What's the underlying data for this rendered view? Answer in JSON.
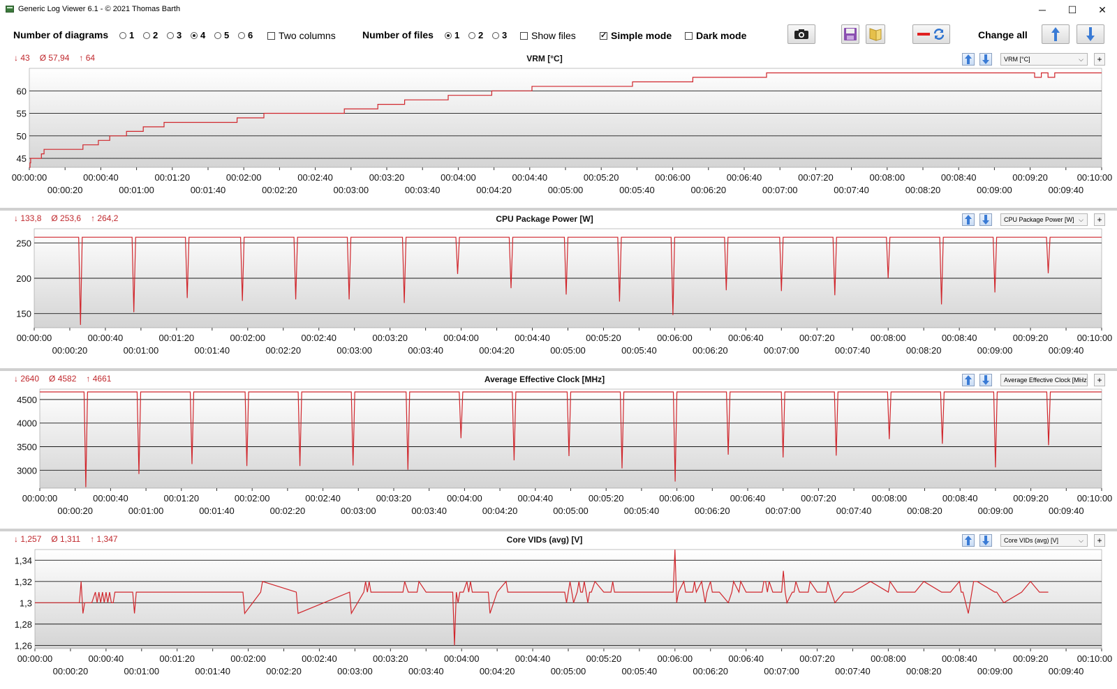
{
  "window": {
    "title": "Generic Log Viewer 6.1 - © 2021 Thomas Barth",
    "min_label": "─",
    "max_label": "☐",
    "close_label": "✕"
  },
  "toolbar": {
    "diagrams_label": "Number of diagrams",
    "diagram_options": [
      "1",
      "2",
      "3",
      "4",
      "5",
      "6"
    ],
    "diagram_selected": "4",
    "two_columns_label": "Two columns",
    "two_columns_checked": false,
    "files_label": "Number of files",
    "file_options": [
      "1",
      "2",
      "3"
    ],
    "file_selected": "1",
    "show_files_label": "Show files",
    "show_files_checked": false,
    "simple_mode_label": "Simple mode",
    "simple_mode_checked": true,
    "dark_mode_label": "Dark mode",
    "dark_mode_checked": false,
    "change_all_label": "Change all",
    "icons": [
      "camera-icon",
      "save-icon",
      "open-folder-icon",
      "remove-line-icon",
      "refresh-icon",
      "arrow-up-icon",
      "arrow-down-icon"
    ]
  },
  "colors": {
    "series": "#d0262c",
    "stats": "#c0282d",
    "button_blue": "#3a7bd5"
  },
  "time_labels": {
    "upper": [
      "00:00:00",
      "00:00:40",
      "00:01:20",
      "00:02:00",
      "00:02:40",
      "00:03:20",
      "00:04:00",
      "00:04:40",
      "00:05:20",
      "00:06:00",
      "00:06:40",
      "00:07:20",
      "00:08:00",
      "00:08:40",
      "00:09:20",
      "00:10:00"
    ],
    "lower": [
      "00:00:20",
      "00:01:00",
      "00:01:40",
      "00:02:20",
      "00:03:00",
      "00:03:40",
      "00:04:20",
      "00:05:00",
      "00:05:40",
      "00:06:20",
      "00:07:00",
      "00:07:40",
      "00:08:20",
      "00:09:00",
      "00:09:40"
    ]
  },
  "chart_data": [
    {
      "type": "line",
      "title": "VRM [°C]",
      "selector": "VRM [°C]",
      "stats": {
        "min": "↓ 43",
        "avg": "Ø 57,94",
        "max": "↑ 64"
      },
      "x_range_seconds": [
        0,
        600
      ],
      "yticks": [
        "45",
        "50",
        "55",
        "60"
      ],
      "ylim": [
        43,
        65
      ],
      "x": [
        0,
        1,
        2,
        4,
        6,
        9,
        12,
        15,
        18,
        20,
        22,
        24,
        26,
        28,
        30,
        32,
        34,
        36,
        38,
        40,
        42,
        44,
        46,
        50,
        55,
        65,
        80,
        80,
        100,
        103,
        120,
        120,
        140,
        145,
        160,
        170,
        170,
        200,
        201,
        230,
        240,
        275,
        278,
        310,
        330,
        340,
        350,
        350,
        390,
        400,
        420,
        440,
        470,
        470,
        520,
        520,
        550,
        560,
        580,
        580,
        610,
        620,
        625,
        640,
        650,
        660,
        670,
        690,
        700,
        720,
        735,
        750,
        780,
        790,
        810,
        900,
        900,
        990,
        990,
        1100,
        1100,
        1200,
        1200,
        1340,
        1340,
        1420,
        1420,
        1490,
        1500,
        1500,
        1510,
        1520,
        1530,
        1560,
        1600
      ],
      "values": [
        43,
        44,
        45,
        45,
        45,
        45,
        45,
        45,
        46,
        46,
        47,
        47,
        47,
        47,
        47,
        47,
        47,
        47,
        47,
        47,
        47,
        47,
        47,
        47,
        47,
        47,
        47,
        48,
        48,
        49,
        49,
        50,
        50,
        51,
        51,
        51,
        52,
        52,
        53,
        53,
        53,
        53,
        53,
        54,
        54,
        54,
        54,
        55,
        55,
        55,
        55,
        55,
        55,
        56,
        56,
        57,
        57,
        58,
        58,
        58,
        58,
        58,
        59,
        59,
        59,
        59,
        59,
        60,
        60,
        60,
        60,
        61,
        61,
        61,
        61,
        61,
        62,
        62,
        63,
        63,
        64,
        64,
        64,
        64,
        64,
        64,
        64,
        64,
        63,
        63,
        64,
        63,
        64,
        64,
        64
      ]
    },
    {
      "type": "line",
      "title": "CPU Package Power [W]",
      "selector": "CPU Package Power [W]",
      "stats": {
        "min": "↓ 133,8",
        "avg": "Ø 253,6",
        "max": "↑ 264,2"
      },
      "x_range_seconds": [
        0,
        600
      ],
      "yticks": [
        "150",
        "200",
        "250"
      ],
      "ylim": [
        130,
        270
      ],
      "spikes": [
        {
          "t": 26,
          "v": 134
        },
        {
          "t": 56,
          "v": 152
        },
        {
          "t": 86,
          "v": 172
        },
        {
          "t": 117,
          "v": 168
        },
        {
          "t": 147,
          "v": 170
        },
        {
          "t": 177,
          "v": 170
        },
        {
          "t": 208,
          "v": 165
        },
        {
          "t": 238,
          "v": 206
        },
        {
          "t": 268,
          "v": 186
        },
        {
          "t": 299,
          "v": 177
        },
        {
          "t": 329,
          "v": 167
        },
        {
          "t": 359,
          "v": 148
        },
        {
          "t": 389,
          "v": 183
        },
        {
          "t": 420,
          "v": 182
        },
        {
          "t": 450,
          "v": 176
        },
        {
          "t": 480,
          "v": 200
        },
        {
          "t": 510,
          "v": 163
        },
        {
          "t": 540,
          "v": 180
        },
        {
          "t": 570,
          "v": 207
        }
      ],
      "baseline": 258
    },
    {
      "type": "line",
      "title": "Average Effective Clock [MHz]",
      "selector": "Average Effective Clock [MHz]",
      "stats": {
        "min": "↓ 2640",
        "avg": "Ø 4582",
        "max": "↑ 4661"
      },
      "x_range_seconds": [
        0,
        600
      ],
      "yticks": [
        "3000",
        "3500",
        "4000",
        "4500"
      ],
      "ylim": [
        2620,
        4720
      ],
      "spikes": [
        {
          "t": 26,
          "v": 2640
        },
        {
          "t": 56,
          "v": 2920
        },
        {
          "t": 86,
          "v": 3130
        },
        {
          "t": 117,
          "v": 3090
        },
        {
          "t": 147,
          "v": 3090
        },
        {
          "t": 177,
          "v": 3100
        },
        {
          "t": 208,
          "v": 3010
        },
        {
          "t": 238,
          "v": 3680
        },
        {
          "t": 268,
          "v": 3210
        },
        {
          "t": 299,
          "v": 3300
        },
        {
          "t": 329,
          "v": 3040
        },
        {
          "t": 359,
          "v": 2760
        },
        {
          "t": 389,
          "v": 3330
        },
        {
          "t": 420,
          "v": 3270
        },
        {
          "t": 450,
          "v": 3310
        },
        {
          "t": 480,
          "v": 3660
        },
        {
          "t": 510,
          "v": 3560
        },
        {
          "t": 540,
          "v": 3060
        },
        {
          "t": 570,
          "v": 3530
        }
      ],
      "baseline": 4661
    },
    {
      "type": "line",
      "title": "Core VIDs (avg) [V]",
      "selector": "Core VIDs (avg) [V]",
      "stats": {
        "min": "↓ 1,257",
        "avg": "Ø 1,311",
        "max": "↑ 1,347"
      },
      "x_range_seconds": [
        0,
        600
      ],
      "yticks": [
        "1,26",
        "1,28",
        "1,3",
        "1,32",
        "1,34"
      ],
      "ylim": [
        1.257,
        1.35
      ],
      "x": [
        0,
        25,
        26,
        27,
        28,
        30,
        32,
        34,
        35,
        36,
        37,
        38,
        39,
        40,
        41,
        42,
        43,
        44,
        45,
        46,
        55,
        56,
        57,
        58,
        80,
        117,
        118,
        127,
        128,
        147,
        148,
        177,
        178,
        185,
        186,
        187,
        188,
        189,
        190,
        200,
        207,
        208,
        210,
        215,
        216,
        220,
        230,
        235,
        236,
        237,
        238,
        239,
        240,
        241,
        243,
        244,
        245,
        246,
        250,
        255,
        256,
        260,
        265,
        266,
        270,
        280,
        290,
        298,
        299,
        300,
        301,
        302,
        303,
        305,
        306,
        307,
        308,
        309,
        310,
        311,
        312,
        313,
        315,
        320,
        324,
        325,
        326,
        330,
        340,
        350,
        359,
        360,
        361,
        362,
        365,
        366,
        370,
        371,
        372,
        375,
        376,
        377,
        378,
        380,
        381,
        383,
        385,
        390,
        392,
        393,
        396,
        397,
        400,
        405,
        409,
        410,
        411,
        412,
        413,
        415,
        420,
        421,
        422,
        423,
        426,
        427,
        428,
        430,
        435,
        436,
        440,
        445,
        446,
        450,
        455,
        460,
        470,
        480,
        481,
        485,
        490,
        495,
        500,
        510,
        515,
        520,
        521,
        522,
        525,
        527,
        528,
        530,
        540,
        541,
        545,
        555,
        560,
        565,
        566,
        570,
        575,
        580,
        585,
        590,
        600
      ],
      "values": [
        1.3,
        1.3,
        1.32,
        1.29,
        1.3,
        1.3,
        1.3,
        1.31,
        1.3,
        1.31,
        1.3,
        1.31,
        1.3,
        1.31,
        1.3,
        1.31,
        1.3,
        1.3,
        1.31,
        1.31,
        1.31,
        1.29,
        1.31,
        1.31,
        1.31,
        1.31,
        1.29,
        1.31,
        1.32,
        1.31,
        1.29,
        1.31,
        1.29,
        1.31,
        1.32,
        1.31,
        1.32,
        1.31,
        1.31,
        1.31,
        1.31,
        1.32,
        1.31,
        1.31,
        1.32,
        1.31,
        1.31,
        1.31,
        1.26,
        1.31,
        1.3,
        1.31,
        1.31,
        1.31,
        1.32,
        1.31,
        1.32,
        1.31,
        1.31,
        1.31,
        1.29,
        1.31,
        1.32,
        1.31,
        1.31,
        1.31,
        1.31,
        1.31,
        1.3,
        1.31,
        1.32,
        1.31,
        1.3,
        1.31,
        1.32,
        1.31,
        1.31,
        1.32,
        1.31,
        1.3,
        1.31,
        1.31,
        1.32,
        1.31,
        1.31,
        1.32,
        1.31,
        1.31,
        1.31,
        1.31,
        1.31,
        1.35,
        1.3,
        1.31,
        1.32,
        1.31,
        1.31,
        1.32,
        1.31,
        1.32,
        1.31,
        1.3,
        1.31,
        1.32,
        1.31,
        1.31,
        1.31,
        1.3,
        1.31,
        1.32,
        1.31,
        1.32,
        1.31,
        1.31,
        1.31,
        1.32,
        1.32,
        1.31,
        1.32,
        1.31,
        1.31,
        1.33,
        1.31,
        1.3,
        1.31,
        1.31,
        1.32,
        1.31,
        1.31,
        1.32,
        1.31,
        1.31,
        1.32,
        1.3,
        1.31,
        1.31,
        1.32,
        1.31,
        1.32,
        1.31,
        1.31,
        1.31,
        1.32,
        1.31,
        1.31,
        1.32,
        1.31,
        1.31,
        1.29,
        1.31,
        1.32,
        1.32,
        1.31,
        1.31,
        1.3,
        1.31,
        1.32,
        1.31,
        1.31,
        1.31
      ]
    }
  ]
}
